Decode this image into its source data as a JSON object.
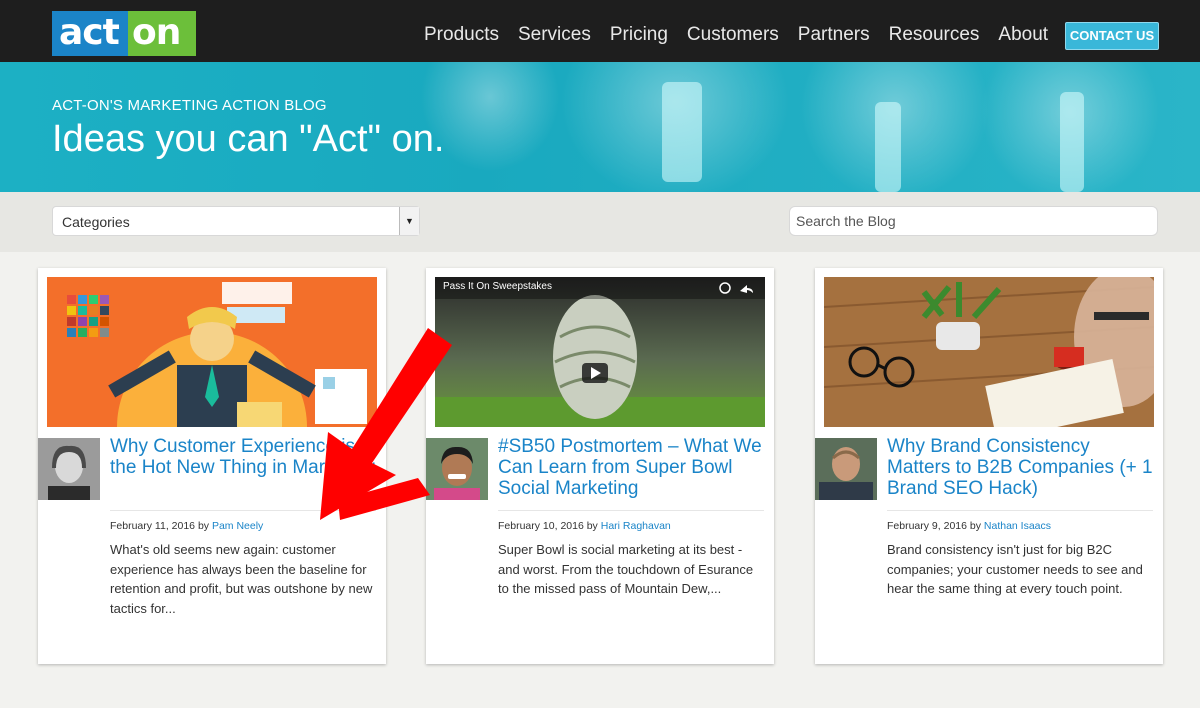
{
  "header": {
    "logo_left": "act",
    "logo_right": "on",
    "nav": [
      "Products",
      "Services",
      "Pricing",
      "Customers",
      "Partners",
      "Resources",
      "About"
    ],
    "contact_label": "CONTACT US"
  },
  "hero": {
    "subtitle": "ACT-ON'S MARKETING ACTION BLOG",
    "title": "Ideas you can \"Act\" on."
  },
  "filters": {
    "categories_label": "Categories",
    "search_placeholder": "Search the Blog"
  },
  "posts": [
    {
      "title": "Why Customer Experience is the Hot New Thing in Marketing",
      "date": "February 11, 2016 by ",
      "author": "Pam Neely",
      "excerpt": "What's old seems new again: customer experience has always been the baseline for retention and profit, but was outshone by new tactics for..."
    },
    {
      "title": "#SB50 Postmortem – What We Can Learn from Super Bowl Social Marketing",
      "date": "February 10, 2016 by ",
      "author": "Hari Raghavan",
      "excerpt": "Super Bowl is social marketing at its best - and worst. From the touchdown of Esurance to the missed pass of Mountain Dew,...",
      "video_title": "Pass It On Sweepstakes"
    },
    {
      "title": "Why Brand Consistency Matters to B2B Companies (+ 1 Brand SEO Hack)",
      "date": "February 9, 2016 by ",
      "author": "Nathan Isaacs",
      "excerpt": "Brand consistency isn't just for big B2C companies; your customer needs to see and hear the same thing at every touch point."
    }
  ],
  "colors": {
    "topbar": "#1e1e1e",
    "hero": "#1cb0c4",
    "link": "#1a84c8",
    "contact": "#39b7d9",
    "annotation_arrow": "#ff0000"
  }
}
